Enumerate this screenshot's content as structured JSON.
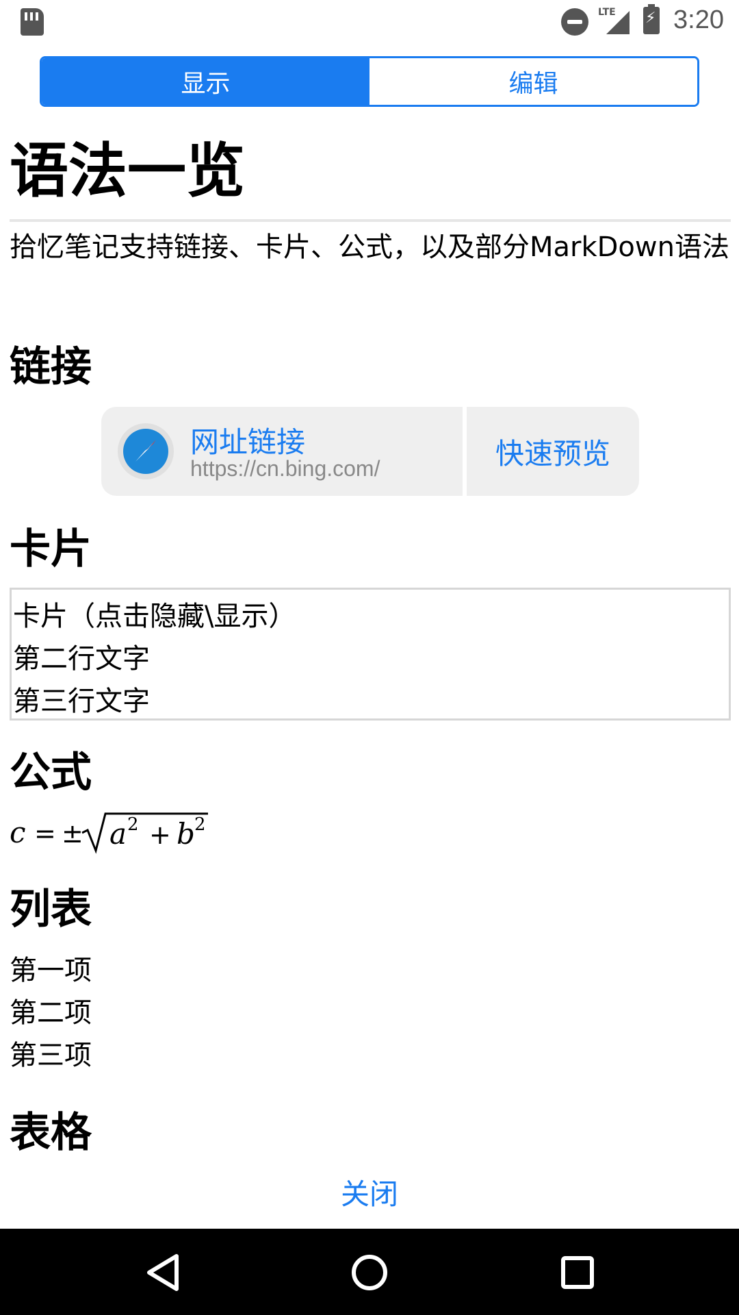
{
  "status_bar": {
    "time": "3:20",
    "network_label": "LTE",
    "icons": [
      "sd-card-icon",
      "do-not-disturb-icon",
      "lte-signal-icon",
      "battery-charging-icon"
    ]
  },
  "tabs": [
    {
      "label": "显示",
      "active": true
    },
    {
      "label": "编辑",
      "active": false
    }
  ],
  "document": {
    "title": "语法一览",
    "intro": "拾忆笔记支持链接、卡片、公式，以及部分MarkDown语法",
    "sections": {
      "links": "链接",
      "card": "卡片",
      "formula": "公式",
      "list": "列表",
      "table": "表格"
    },
    "link_card": {
      "title": "网址链接",
      "url": "https://cn.bing.com/",
      "preview_button": "快速预览"
    },
    "card_lines": [
      "卡片（点击隐藏\\显示）",
      "第二行文字",
      "第三行文字"
    ],
    "formula_text": "c = ±√(a² + b²)",
    "list_items": [
      "第一项",
      "第二项",
      "第三项"
    ]
  },
  "close_label": "关闭",
  "colors": {
    "accent": "#1a7cf0",
    "link_card_bg": "#efefef",
    "navbar_bg": "#000000"
  }
}
